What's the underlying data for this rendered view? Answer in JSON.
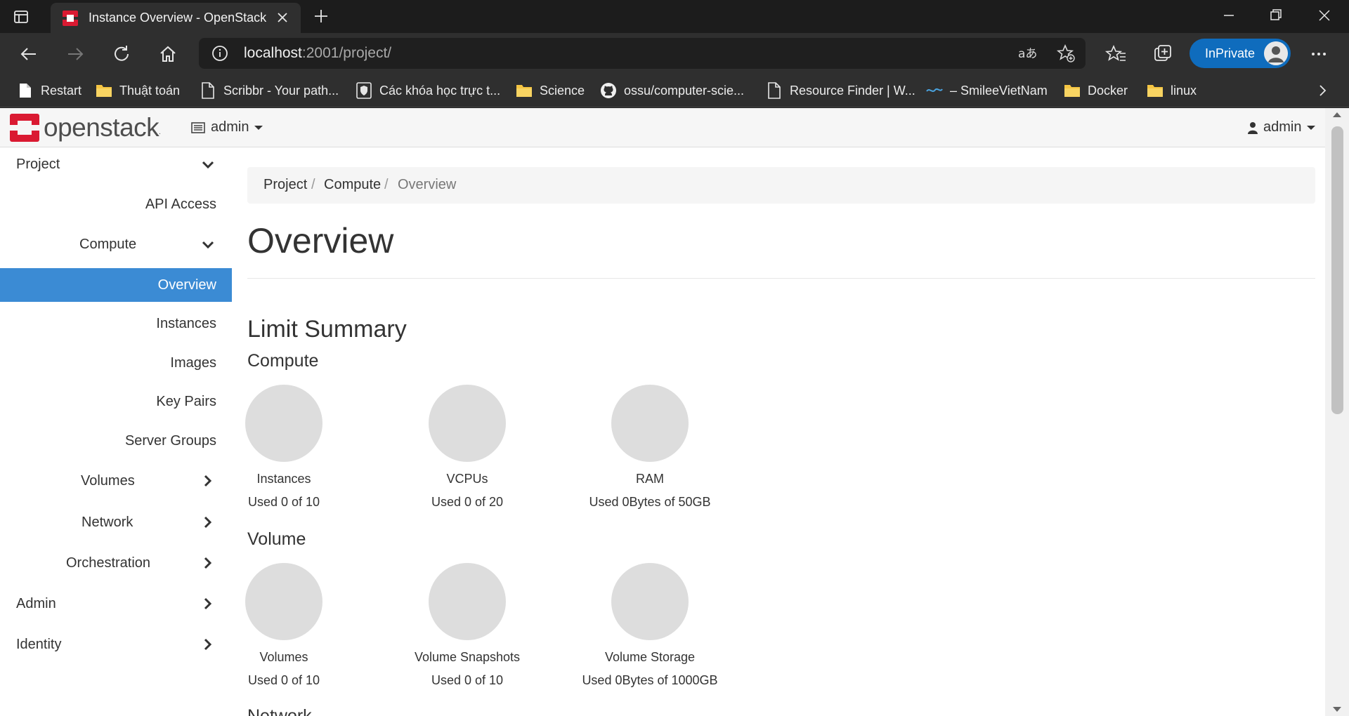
{
  "browser": {
    "tab_title": "Instance Overview - OpenStack D",
    "url_host": "localhost",
    "url_path": ":2001/project/",
    "inprivate_label": "InPrivate",
    "bookmarks": [
      {
        "label": "Restart",
        "icon": "restart-page-icon"
      },
      {
        "label": "Thuật toán",
        "icon": "folder-icon"
      },
      {
        "label": "Scribbr - Your path...",
        "icon": "page-icon"
      },
      {
        "label": "Các khóa học trực t...",
        "icon": "shield-page-icon"
      },
      {
        "label": "Science",
        "icon": "folder-icon"
      },
      {
        "label": "ossu/computer-scie...",
        "icon": "github-icon"
      },
      {
        "label": "Resource Finder | W...",
        "icon": "page-icon"
      },
      {
        "label": "– SmileeVietNam",
        "icon": "smilee-logo-icon"
      },
      {
        "label": "Docker",
        "icon": "folder-icon"
      },
      {
        "label": "linux",
        "icon": "folder-icon"
      }
    ]
  },
  "header": {
    "brand": "openstack",
    "brand_mark": ".",
    "project_selector": "admin",
    "user_menu": "admin"
  },
  "sidebar": {
    "items": [
      {
        "label": "Project",
        "chevron": "down"
      },
      {
        "label": "API Access"
      },
      {
        "label": "Compute",
        "chevron": "down"
      },
      {
        "label": "Overview",
        "active": true
      },
      {
        "label": "Instances"
      },
      {
        "label": "Images"
      },
      {
        "label": "Key Pairs"
      },
      {
        "label": "Server Groups"
      },
      {
        "label": "Volumes",
        "chevron": "right"
      },
      {
        "label": "Network",
        "chevron": "right"
      },
      {
        "label": "Orchestration",
        "chevron": "right"
      },
      {
        "label": "Admin",
        "chevron": "right"
      },
      {
        "label": "Identity",
        "chevron": "right"
      }
    ]
  },
  "main": {
    "breadcrumb": [
      "Project",
      "Compute",
      "Overview"
    ],
    "title": "Overview",
    "limit_summary": "Limit Summary",
    "compute": {
      "heading": "Compute",
      "items": [
        {
          "name": "Instances",
          "usage": "Used 0 of 10"
        },
        {
          "name": "VCPUs",
          "usage": "Used 0 of 20"
        },
        {
          "name": "RAM",
          "usage": "Used 0Bytes of 50GB"
        }
      ]
    },
    "volume": {
      "heading": "Volume",
      "items": [
        {
          "name": "Volumes",
          "usage": "Used 0 of 10"
        },
        {
          "name": "Volume Snapshots",
          "usage": "Used 0 of 10"
        },
        {
          "name": "Volume Storage",
          "usage": "Used 0Bytes of 1000GB"
        }
      ]
    },
    "next_section": "Network"
  },
  "colors": {
    "active_nav": "#3b8bd4",
    "openstack_red": "#da1a32",
    "inprivate_blue": "#0f6cbd"
  }
}
